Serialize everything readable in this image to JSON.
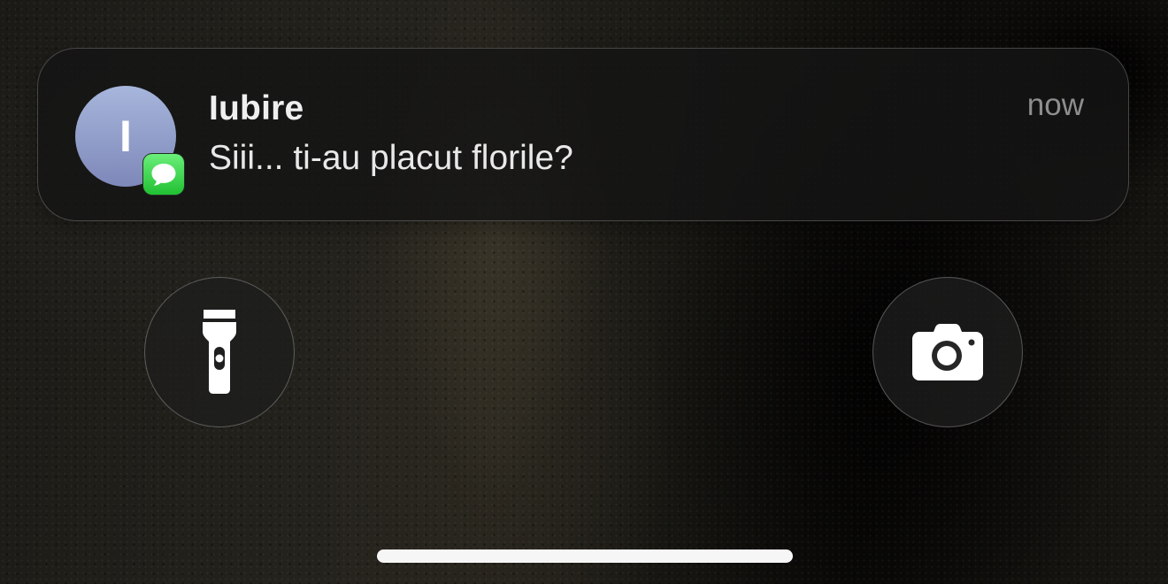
{
  "notification": {
    "avatar_initial": "I",
    "app_badge_icon": "messages-icon",
    "sender": "Iubire",
    "message": "Siii... ti-au placut florile?",
    "time": "now",
    "colors": {
      "avatar_top": "#a7b6dc",
      "avatar_bottom": "#7e88b9",
      "badge_green": "#34c759"
    }
  },
  "quick_actions": {
    "left_icon": "flashlight-icon",
    "right_icon": "camera-icon"
  },
  "home_indicator": {
    "color": "#f6f6f6"
  }
}
